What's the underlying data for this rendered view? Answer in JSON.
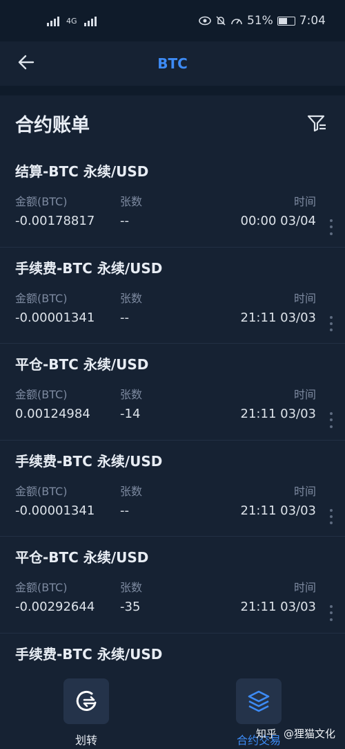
{
  "status_bar": {
    "network": "4G",
    "battery": "51%",
    "time": "7:04"
  },
  "nav": {
    "title": "BTC",
    "back_icon": "arrow-left-icon"
  },
  "section": {
    "title": "合约账单",
    "filter_icon": "filter-icon"
  },
  "columns": {
    "amount": "金额(BTC)",
    "count": "张数",
    "time": "时间"
  },
  "records": [
    {
      "title": "结算-BTC 永续/USD",
      "amount": "-0.00178817",
      "count": "--",
      "time": "00:00 03/04"
    },
    {
      "title": "手续费-BTC 永续/USD",
      "amount": "-0.00001341",
      "count": "--",
      "time": "21:11 03/03"
    },
    {
      "title": "平仓-BTC 永续/USD",
      "amount": "0.00124984",
      "count": "-14",
      "time": "21:11 03/03"
    },
    {
      "title": "手续费-BTC 永续/USD",
      "amount": "-0.00001341",
      "count": "--",
      "time": "21:11 03/03"
    },
    {
      "title": "平仓-BTC 永续/USD",
      "amount": "-0.00292644",
      "count": "-35",
      "time": "21:11 03/03"
    },
    {
      "title": "手续费-BTC 永续/USD",
      "amount": "",
      "count": "",
      "time": ""
    }
  ],
  "actions": {
    "transfer_label": "划转",
    "contract_label": "合约交易",
    "transfer_icon": "transfer-icon",
    "contract_icon": "layers-icon"
  },
  "watermark": {
    "site": "知乎",
    "author": "@狸猫文化"
  },
  "colors": {
    "background": "#0f1b2a",
    "panel": "#162233",
    "accent": "#3d8bf5",
    "muted": "#7d8aa0"
  }
}
